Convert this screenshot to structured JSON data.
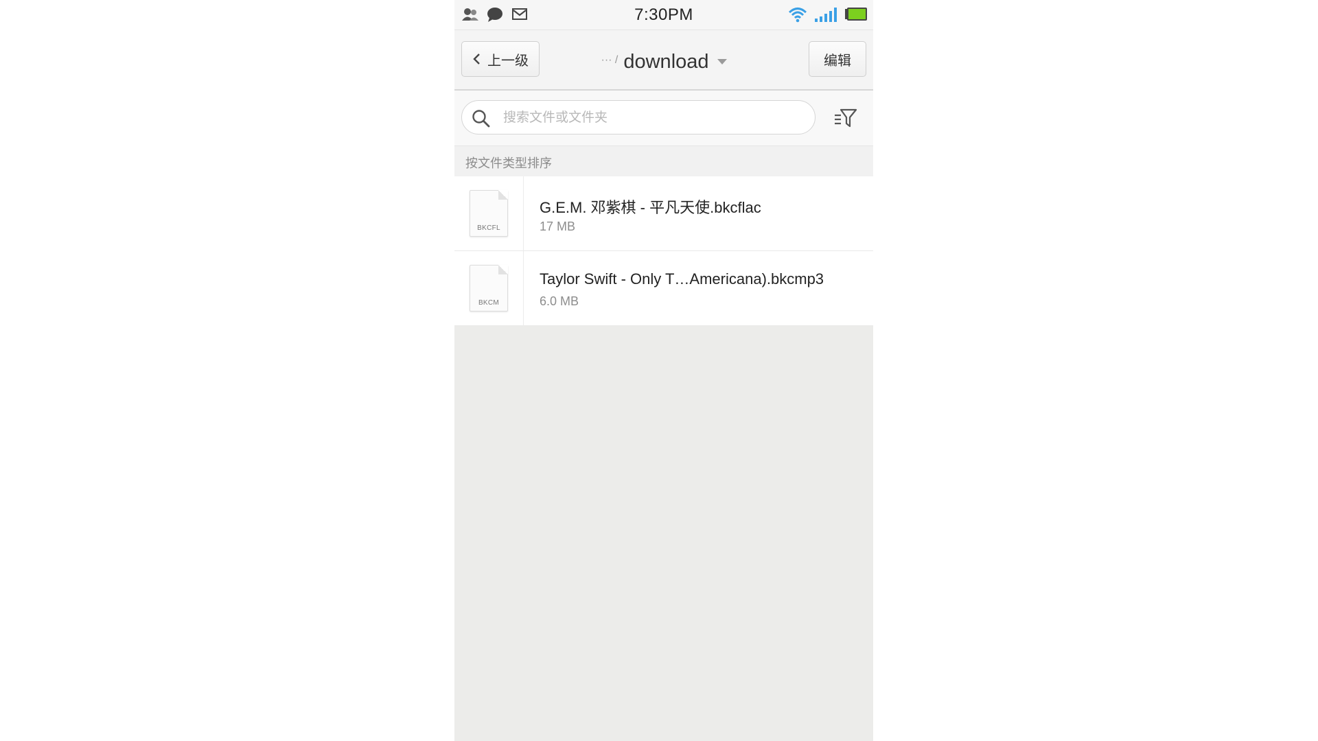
{
  "status_bar": {
    "time": "7:30PM",
    "left_icons": [
      "contacts-icon",
      "chat-bubble-icon",
      "mail-icon"
    ],
    "right_icons": [
      "wifi-icon",
      "signal-icon",
      "battery-icon"
    ],
    "battery_color": "#7ccf1f",
    "wifi_color": "#3aa0e6"
  },
  "action_bar": {
    "back_label": "上一级",
    "breadcrumb": "··· /",
    "folder_title": "download",
    "edit_label": "编辑"
  },
  "search": {
    "placeholder": "搜索文件或文件夹",
    "value": ""
  },
  "sort_label": "按文件类型排序",
  "files": [
    {
      "icon_ext": "BKCFL",
      "name": "G.E.M. 邓紫棋 - 平凡天使.bkcflac",
      "size": "17 MB"
    },
    {
      "icon_ext": "BKCM",
      "name": "Taylor Swift - Only T…Americana).bkcmp3",
      "size": "6.0 MB"
    }
  ]
}
